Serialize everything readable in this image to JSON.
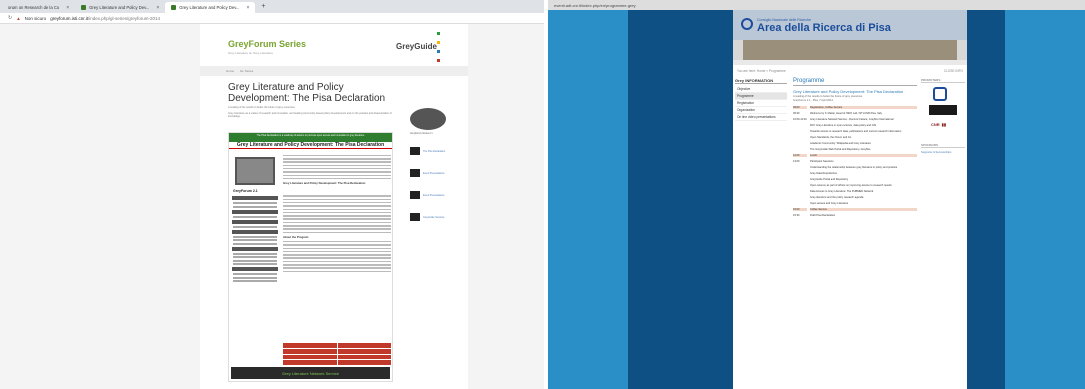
{
  "left_browser": {
    "tabs": [
      {
        "label": "orum on Research de la Co",
        "active": false
      },
      {
        "label": "Grey Literature and Policy Dev...",
        "active": false
      },
      {
        "label": "Grey Literature and Policy Dev...",
        "active": true
      }
    ],
    "new_tab": "+",
    "security": "Non sicuro",
    "url_host": "greyforum.isti.cnr.it",
    "url_path": "/index.php/gl-series/greyforum-2014"
  },
  "greyforum": {
    "site_title": "GreyForum Series",
    "tagline": "Grey Literature on Grey Literature",
    "logo": "GreyGuide",
    "menu": [
      "Home",
      "GL Series"
    ],
    "page_title": "Grey Literature and Policy Development: The Pisa Declaration",
    "intro_1": "A reading of the results to better the future of grey resources",
    "intro_2": "Grey Literature as a matter of research and innovation, and leading community-based policy developments and on the practice and dissemination of knowledge.",
    "poster": {
      "banner": "The Pisa Declaration is a roadmap of actions to promote open access and innovation in grey literature",
      "title": "Grey Literature and Policy Development: The Pisa Declaration",
      "event": "GreyForum 2.1",
      "subheading": "Grey Literature and Policy Development: The Pisa Declaration",
      "about": "About the Program",
      "left_labels": [
        "Location",
        "Date",
        "Time",
        "Venue",
        "Contact"
      ],
      "footer": "Grey Literature Network Service"
    },
    "sidebar": {
      "event_caption": "GreyForum Series 2.1",
      "items": [
        "The Pisa Declaration",
        "Event Presentations",
        "Event Presentations",
        "GreyGuide Services"
      ]
    }
  },
  "right_browser": {
    "url": "eventi.adt.cnr.it/index.php/en/programme-grey"
  },
  "area_ricerca": {
    "subtitle": "Consiglio Nazionale delle Ricerche",
    "title": "Area della Ricerca di Pisa",
    "breadcrumb": "You are here: Home > Programme",
    "close_info": "CLOSE INFO",
    "left_nav_heading": "Grey INFORMATION",
    "left_nav": [
      "Objective",
      "Programme",
      "Registration",
      "Organization",
      "On line video presentations"
    ],
    "selected_nav": "Programme",
    "main_heading": "Programme",
    "event_title": "Grey Literature and Policy Development: The Pisa Declaration",
    "event_sub": "A reading of the results to better the future of grey resources",
    "event_meta": "GreyForum 2.1 - Pisa, 7 April 2014",
    "programme": [
      {
        "time": "09:00",
        "event": "Registration, Coffee Service",
        "highlight": true
      },
      {
        "time": "09:30",
        "event": "Welcome by F. Mattei, Head of INFO Lab, ISTI-CNR Pisa, Italy",
        "highlight": false
      },
      {
        "time": "10:00-11:00",
        "event": "Grey Literature Network Service - Dominic Farace, GreyNet International",
        "highlight": false
      },
      {
        "time": "",
        "event": "ROI: Grey Literature in open science, data policy and OAI",
        "highlight": false
      },
      {
        "time": "",
        "event": "Towards access to research data, publications and current research information",
        "highlight": false
      },
      {
        "time": "",
        "event": "Open Standards, the Cloud, and GL",
        "highlight": false
      },
      {
        "time": "",
        "event": "Academic Community: Wikipedia and Grey Literature",
        "highlight": false
      },
      {
        "time": "",
        "event": "The GreyGuide Web Portal and Repository, GreyNet",
        "highlight": false
      },
      {
        "time": "12:00",
        "event": "Lunch",
        "highlight": true
      },
      {
        "time": "13:00",
        "event": "Participant Sessions",
        "highlight": false
      },
      {
        "time": "",
        "event": "Understanding the relationship between grey literature in policy and practice",
        "highlight": false
      },
      {
        "time": "",
        "event": "Grey Data Repositories",
        "highlight": false
      },
      {
        "time": "",
        "event": "GreyGuide Portal and Repository",
        "highlight": false
      },
      {
        "time": "",
        "event": "Open science as part of efforts on improving access to research results",
        "highlight": false
      },
      {
        "time": "",
        "event": "Data Access to Grey Literature: The PUBMED Network",
        "highlight": false
      },
      {
        "time": "",
        "event": "Grey literature and the policy research agenda",
        "highlight": false
      },
      {
        "time": "",
        "event": "Open access and Grey Literature",
        "highlight": false
      },
      {
        "time": "15:00",
        "event": "Coffee Service",
        "highlight": true
      },
      {
        "time": "15:30",
        "event": "Draft Pisa Declaration",
        "highlight": false
      }
    ],
    "right_heading_1": "PROMOTERS",
    "right_heading_2": "SPONSORS",
    "right_link": "Supporter & Sponsorships",
    "logo3_text": "CNR"
  }
}
